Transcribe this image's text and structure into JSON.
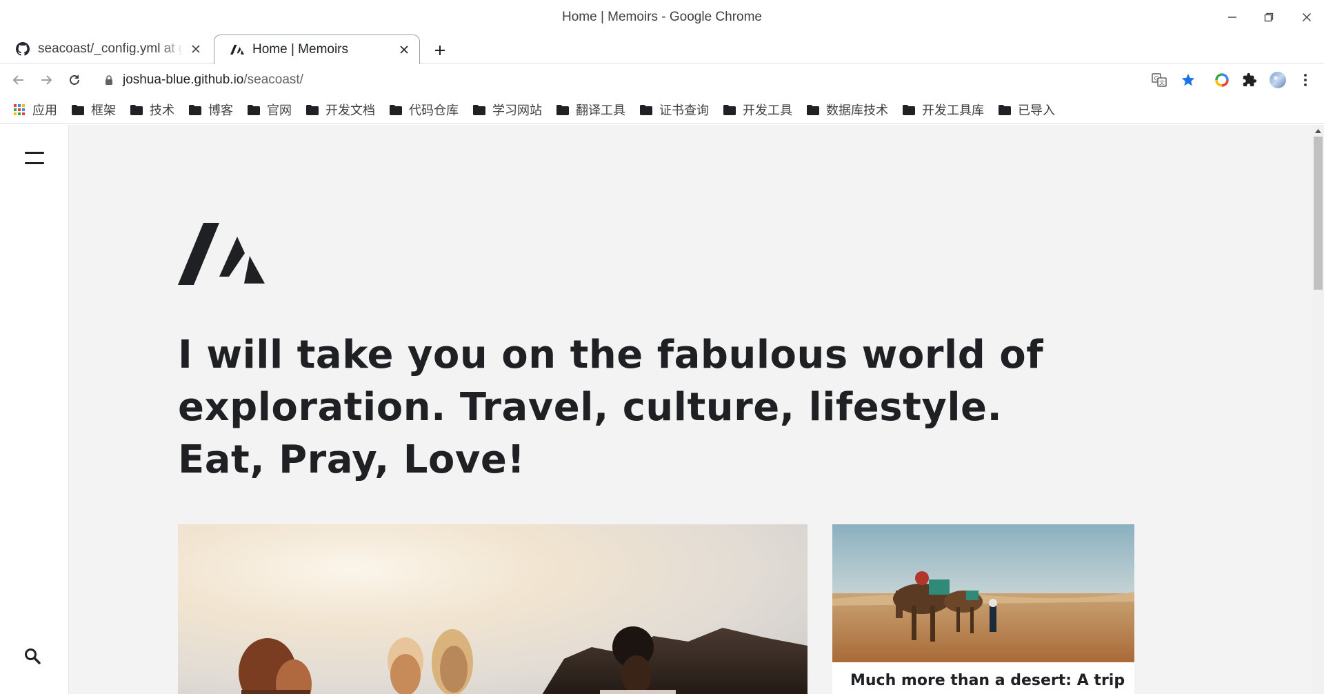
{
  "window": {
    "title": "Home | Memoirs - Google Chrome"
  },
  "tabs": [
    {
      "label": "seacoast/_config.yml at gh",
      "icon": "github-icon",
      "active": false
    },
    {
      "label": "Home | Memoirs",
      "icon": "memoirs-logo-icon",
      "active": true
    }
  ],
  "toolbar": {
    "url_host": "joshua-blue.github.io",
    "url_path": "/seacoast/"
  },
  "bookmarks": [
    {
      "label": "应用",
      "icon": "apps-grid-icon"
    },
    {
      "label": "框架",
      "icon": "folder-icon"
    },
    {
      "label": "技术",
      "icon": "folder-icon"
    },
    {
      "label": "博客",
      "icon": "folder-icon"
    },
    {
      "label": "官网",
      "icon": "folder-icon"
    },
    {
      "label": "开发文档",
      "icon": "folder-icon"
    },
    {
      "label": "代码仓库",
      "icon": "folder-icon"
    },
    {
      "label": "学习网站",
      "icon": "folder-icon"
    },
    {
      "label": "翻译工具",
      "icon": "folder-icon"
    },
    {
      "label": "证书查询",
      "icon": "folder-icon"
    },
    {
      "label": "开发工具",
      "icon": "folder-icon"
    },
    {
      "label": "数据库技术",
      "icon": "folder-icon"
    },
    {
      "label": "开发工具库",
      "icon": "folder-icon"
    },
    {
      "label": "已导入",
      "icon": "folder-icon"
    }
  ],
  "page": {
    "hero_text": "I will take you on the fabulous world of exploration. Travel, culture, lifestyle. Eat, Pray, Love!",
    "featured_post_title": "Much more than a desert: A trip",
    "colors": {
      "background": "#f3f3f3",
      "text": "#1f2024",
      "sidebar": "#ffffff"
    }
  }
}
